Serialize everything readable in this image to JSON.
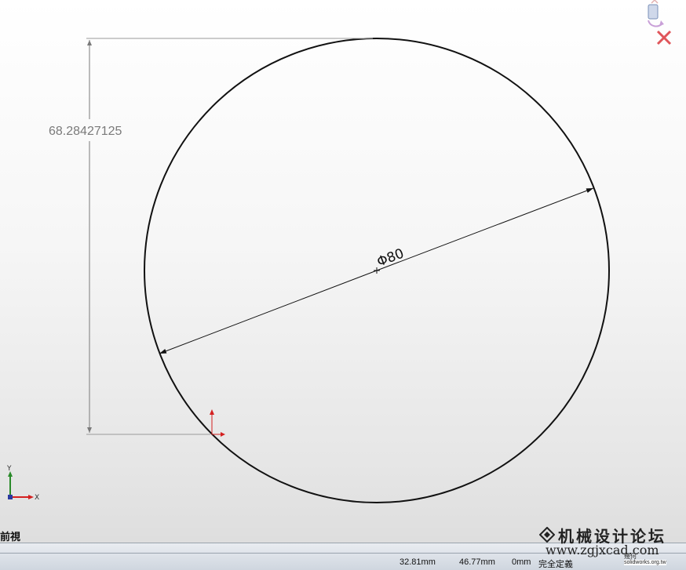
{
  "sketch": {
    "vertical_dimension": "68.28427125",
    "diameter_dimension": "Φ80"
  },
  "axes": {
    "x_label": "X",
    "y_label": "Y"
  },
  "view": {
    "label": "前視"
  },
  "statusbar": {
    "x_coord": "32.81mm",
    "y_coord": "46.77mm",
    "z_coord": "0mm",
    "status": "完全定義"
  },
  "watermark": {
    "site_cn": "机械设计论坛",
    "url": "www.zgjxcad.com",
    "sub_label": "幾何",
    "org": "solidworks.org.tw"
  },
  "icons": [
    "rebuild-icon",
    "cancel-x-icon",
    "coordinate-triad-icon",
    "sketch-origin-icon",
    "diamond-logo-icon"
  ],
  "colors": {
    "circle": "#111111",
    "dimension": "#7a7a7a",
    "origin_red": "#d42020",
    "axis_green": "#2a8a2a",
    "axis_blue": "#2a3aa0",
    "cancel_red": "#e0555a"
  }
}
